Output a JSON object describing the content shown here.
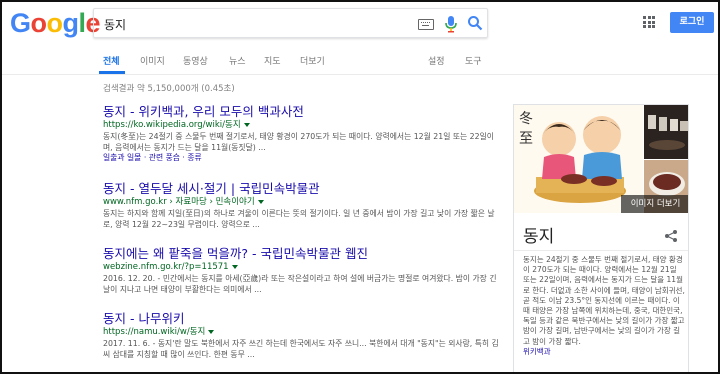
{
  "logo": [
    "G",
    "o",
    "o",
    "g",
    "l",
    "e"
  ],
  "logo_colors": [
    "#4285f4",
    "#ea4335",
    "#fbbc05",
    "#4285f4",
    "#34a853",
    "#ea4335"
  ],
  "search": {
    "value": "동지"
  },
  "header": {
    "login_label": "로그인"
  },
  "tabs": [
    {
      "label": "전체",
      "active": true
    },
    {
      "label": "이미지"
    },
    {
      "label": "동영상"
    },
    {
      "label": "뉴스"
    },
    {
      "label": "지도"
    },
    {
      "label": "더보기"
    },
    {
      "label": "설정"
    },
    {
      "label": "도구"
    }
  ],
  "stats": "검색결과 약 5,150,000개 (0.45초)",
  "results": [
    {
      "title": "동지 - 위키백과, 우리 모두의 백과사전",
      "url": "https://ko.wikipedia.org/wiki/동지",
      "snippet": "동지(冬至)는 24절기 중 스물두 번째 절기로서, 태양 황경이 270도가 되는 때이다. 양력에서는 12월 21일 또는 22일이며, 음력에서는 동지가 드는 달을 11월(동짓달) ...",
      "links": "일출과 일몰 · 관련 풍습 · 종류"
    },
    {
      "title": "동지 - 열두달 세시·절기 | 국립민속박물관",
      "url": "www.nfm.go.kr › 자료마당 › 민속이야기",
      "snippet": "동지는 하지와 함께 지일(至日)의 하나로 겨울이 이른다는 뜻의 절기이다. 일 년 중에서 밤이 가장 길고 낮이 가장 짧은 날로, 양력 12월 22~23일 무렵이다. 양력으로 ..."
    },
    {
      "title": "동지에는 왜 팥죽을 먹을까? - 국립민속박물관 웹진",
      "url": "webzine.nfm.go.kr/?p=11571",
      "snippet": "2016. 12. 20. - 민간에서는 동지를 아세(亞歲)라 또는 작은설이라고 하여 설에 버금가는 명절로 여겨왔다. 밤이 가장 긴 날이 지나고 나면 태양이 부활한다는 의미에서 ..."
    },
    {
      "title": "동지 - 나무위키",
      "url": "https://namu.wiki/w/동지",
      "snippet": "2017. 11. 6. - 동지'란 말도 북한에서 자주 쓰긴 하는데 한국에서도 자주 쓰니... 북한에서 대개 \"동지\"는 외사랑, 특히 김씨 삼대를 지칭할 때 많이 쓰인다. 한편 동무 ..."
    }
  ],
  "knowledge_panel": {
    "title": "동지",
    "more_images": "이미지 더보기",
    "image_calligraphy": "冬至",
    "description": "동지는 24절기 중 스물두 번째 절기로서, 태양 황경이 270도가 되는 때이다. 양력에서는 12월 21일 또는 22일이며, 음력에서는 동지가 드는 달을 11월로 한다. 더없과 소한 사이에 들며, 태양이 남회귀선, 곧 적도 이남 23.5°인 동지선에 이르는 때이다. 이때 태양은 가장 남쪽에 위치하는데, 중국, 대한민국, 독일 등과 같은 북반구에서는 낮의 길이가 가장 짧고 밤이 가장 길며, 남반구에서는 낮의 길이가 가장 길고 밤이 가장 짧다.",
    "source": "위키백과"
  },
  "colors": {
    "accent": "#1a73e8",
    "link": "#1a0dab",
    "url": "#006621",
    "button": "#4285f4"
  }
}
